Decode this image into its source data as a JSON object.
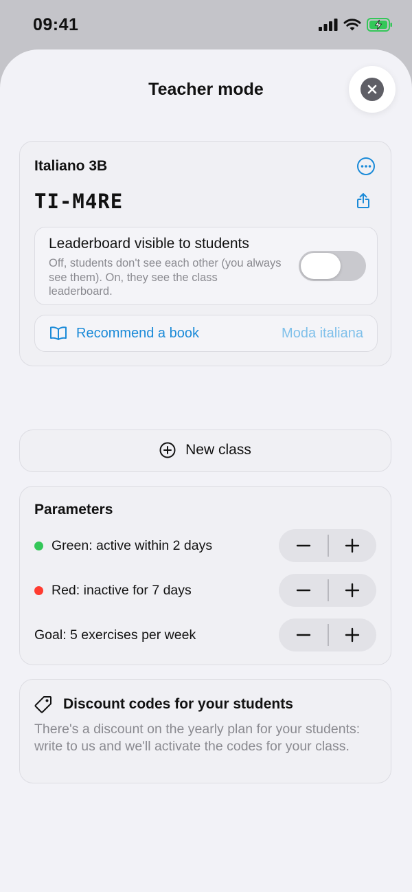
{
  "status_bar": {
    "time": "09:41"
  },
  "sheet": {
    "title": "Teacher mode"
  },
  "class_card": {
    "name": "Italiano 3B",
    "code": "TI-M4RE",
    "leaderboard": {
      "title": "Leaderboard visible to students",
      "description": "Off, students don't see each other (you always see them). On, they see the class leaderboard.",
      "enabled": false
    },
    "recommend": {
      "label": "Recommend a book",
      "value": "Moda italiana"
    }
  },
  "new_class": {
    "label": "New class"
  },
  "parameters": {
    "title": "Parameters",
    "rows": [
      {
        "label": "Green: active within 2 days",
        "dot_color": "#34c759"
      },
      {
        "label": "Red: inactive for 7 days",
        "dot_color": "#ff3b30"
      },
      {
        "label": "Goal: 5 exercises per week",
        "dot_color": ""
      }
    ]
  },
  "discount": {
    "title": "Discount codes for your students",
    "description": "There's a discount on the yearly plan for your students: write to us and we'll activate the codes for your class."
  },
  "colors": {
    "accent": "#1a8ad8",
    "accent_light": "#7fc0ea",
    "background": "#f2f2f7"
  }
}
